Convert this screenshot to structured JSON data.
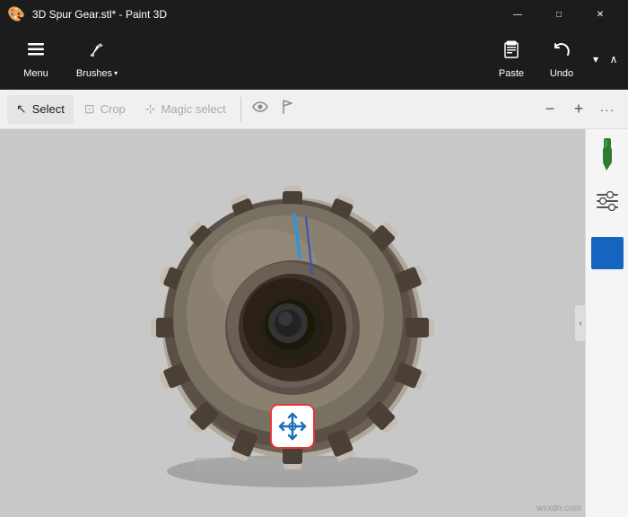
{
  "titlebar": {
    "title": "3D Spur Gear.stl* - Paint 3D",
    "controls": {
      "minimize": "—",
      "maximize": "□",
      "close": "✕"
    }
  },
  "toolbar": {
    "menu_label": "Menu",
    "brushes_label": "Brushes",
    "paste_label": "Paste",
    "undo_label": "Undo"
  },
  "commandbar": {
    "select_label": "Select",
    "crop_label": "Crop",
    "magic_select_label": "Magic select",
    "minus_label": "−",
    "plus_label": "+",
    "more_label": "···"
  },
  "sidebar": {
    "collapse_icon": "‹"
  },
  "colors": {
    "accent_blue": "#1565C0",
    "gear_color": "#8a8070",
    "background": "#c8c8c8",
    "sidebar_color": "#1565C0"
  },
  "watermark": "wsxdn.com"
}
